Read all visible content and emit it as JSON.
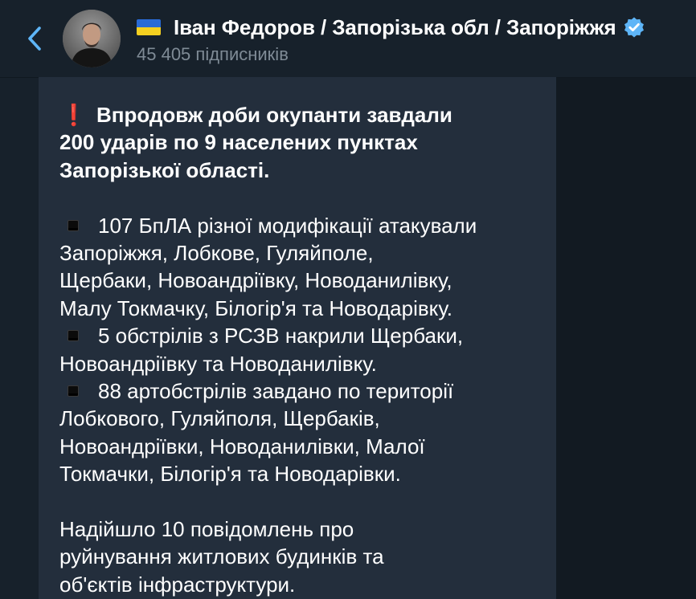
{
  "header": {
    "back_icon": "chevron-left-icon",
    "avatar_icon": "channel-avatar",
    "flag_icon": "ukraine-flag-icon",
    "title": "Іван Федоров / Запорізька обл / Запоріжжя",
    "verified_icon": "verified-badge-icon",
    "subscribers": "45 405 підписників"
  },
  "message": {
    "headline_icon": "exclamation-icon",
    "headline": [
      "Впродовж доби окупанти завдали",
      "200 ударів по 9 населених пунктах",
      "Запорізької області."
    ],
    "bullet_icon": "black-square-icon",
    "items": [
      {
        "lines": [
          "107 БпЛА різної модифікації атакували",
          "Запоріжжя, Лобкове, Гуляйполе,",
          "Щербаки, Новоандріївку, Новоданилівку,",
          "Малу Токмачку, Білогір'я та Новодарівку."
        ]
      },
      {
        "lines": [
          "5 обстрілів з РСЗВ накрили Щербаки,",
          "Новоандріївку та Новоданилівку."
        ]
      },
      {
        "lines": [
          "88 артобстрілів завдано по території",
          "Лобкового, Гуляйполя, Щербаків,",
          "Новоандріївки, Новоданилівки, Малої",
          "Токмачки, Білогір'я та Новодарівки."
        ]
      }
    ],
    "footer": [
      "Надійшло 10 повідомлень про",
      "руйнування житлових будинків та",
      "об'єктів інфраструктури."
    ]
  },
  "colors": {
    "background": "#17212b",
    "bubble": "#232e3c",
    "accent": "#5eb5f7",
    "subtitle": "#7f8b96",
    "alert": "#e0242c"
  }
}
